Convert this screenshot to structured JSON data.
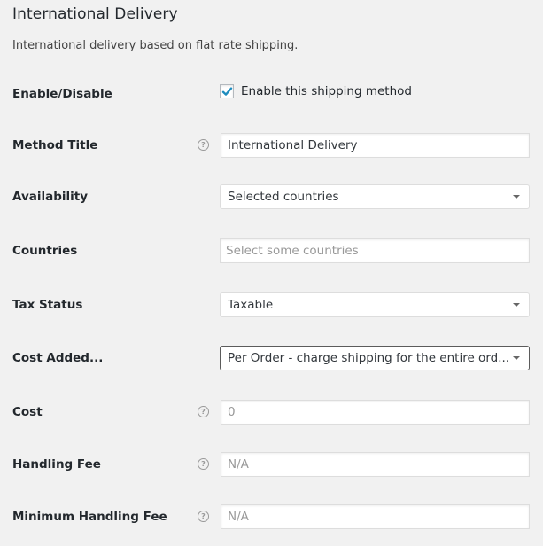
{
  "header": {
    "title": "International Delivery",
    "description": "International delivery based on flat rate shipping."
  },
  "fields": {
    "enable": {
      "label": "Enable/Disable",
      "checkbox_label": "Enable this shipping method",
      "checked": true
    },
    "method_title": {
      "label": "Method Title",
      "value": "International Delivery",
      "help_icon": "question-circle-icon"
    },
    "availability": {
      "label": "Availability",
      "selected": "Selected countries"
    },
    "countries": {
      "label": "Countries",
      "placeholder": "Select some countries"
    },
    "tax_status": {
      "label": "Tax Status",
      "selected": "Taxable"
    },
    "cost_added": {
      "label": "Cost Added...",
      "selected": "Per Order - charge shipping for the entire ord..."
    },
    "cost": {
      "label": "Cost",
      "placeholder": "0",
      "help_icon": "question-circle-icon"
    },
    "handling_fee": {
      "label": "Handling Fee",
      "placeholder": "N/A",
      "help_icon": "question-circle-icon"
    },
    "minimum_handling_fee": {
      "label": "Minimum Handling Fee",
      "placeholder": "N/A",
      "help_icon": "question-circle-icon"
    }
  },
  "colors": {
    "background": "#f1f1f1",
    "checkmark": "#1e8cbe",
    "label_text": "#23282d",
    "placeholder_text": "#999999"
  }
}
